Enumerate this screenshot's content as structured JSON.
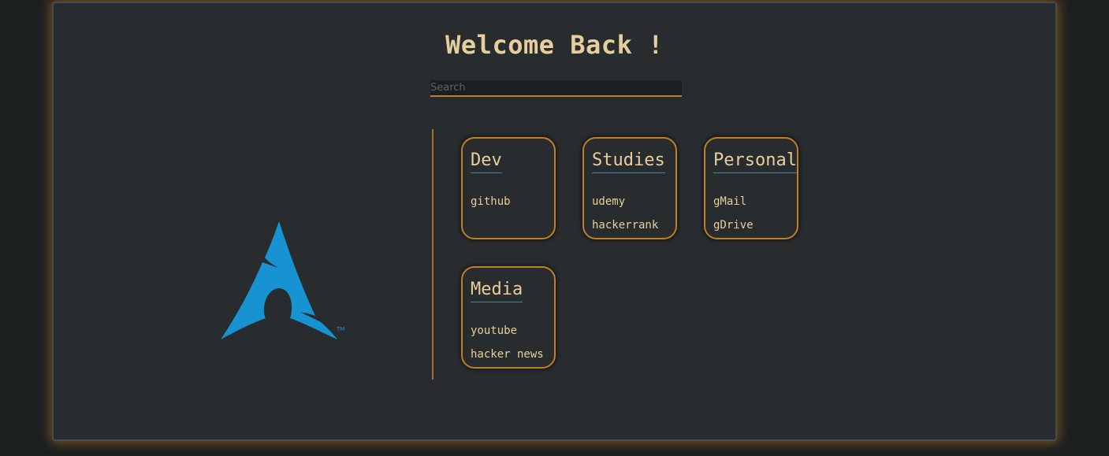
{
  "header": {
    "title": "Welcome Back !"
  },
  "search": {
    "placeholder": "Search"
  },
  "logo": {
    "icon": "arch-linux-logo-icon",
    "trademark": "TM"
  },
  "colors": {
    "background": "#1d2021",
    "panel": "#282c2f",
    "accent": "#c17f26",
    "text": "#e6cf9c",
    "underline": "#3f8b92",
    "logo": "#1793d1"
  },
  "cards": [
    {
      "title": "Dev",
      "links": [
        "github"
      ]
    },
    {
      "title": "Studies",
      "links": [
        "udemy",
        "hackerrank"
      ]
    },
    {
      "title": "Personal",
      "links": [
        "gMail",
        "gDrive"
      ]
    },
    {
      "title": "Media",
      "links": [
        "youtube",
        "hacker news"
      ]
    }
  ]
}
